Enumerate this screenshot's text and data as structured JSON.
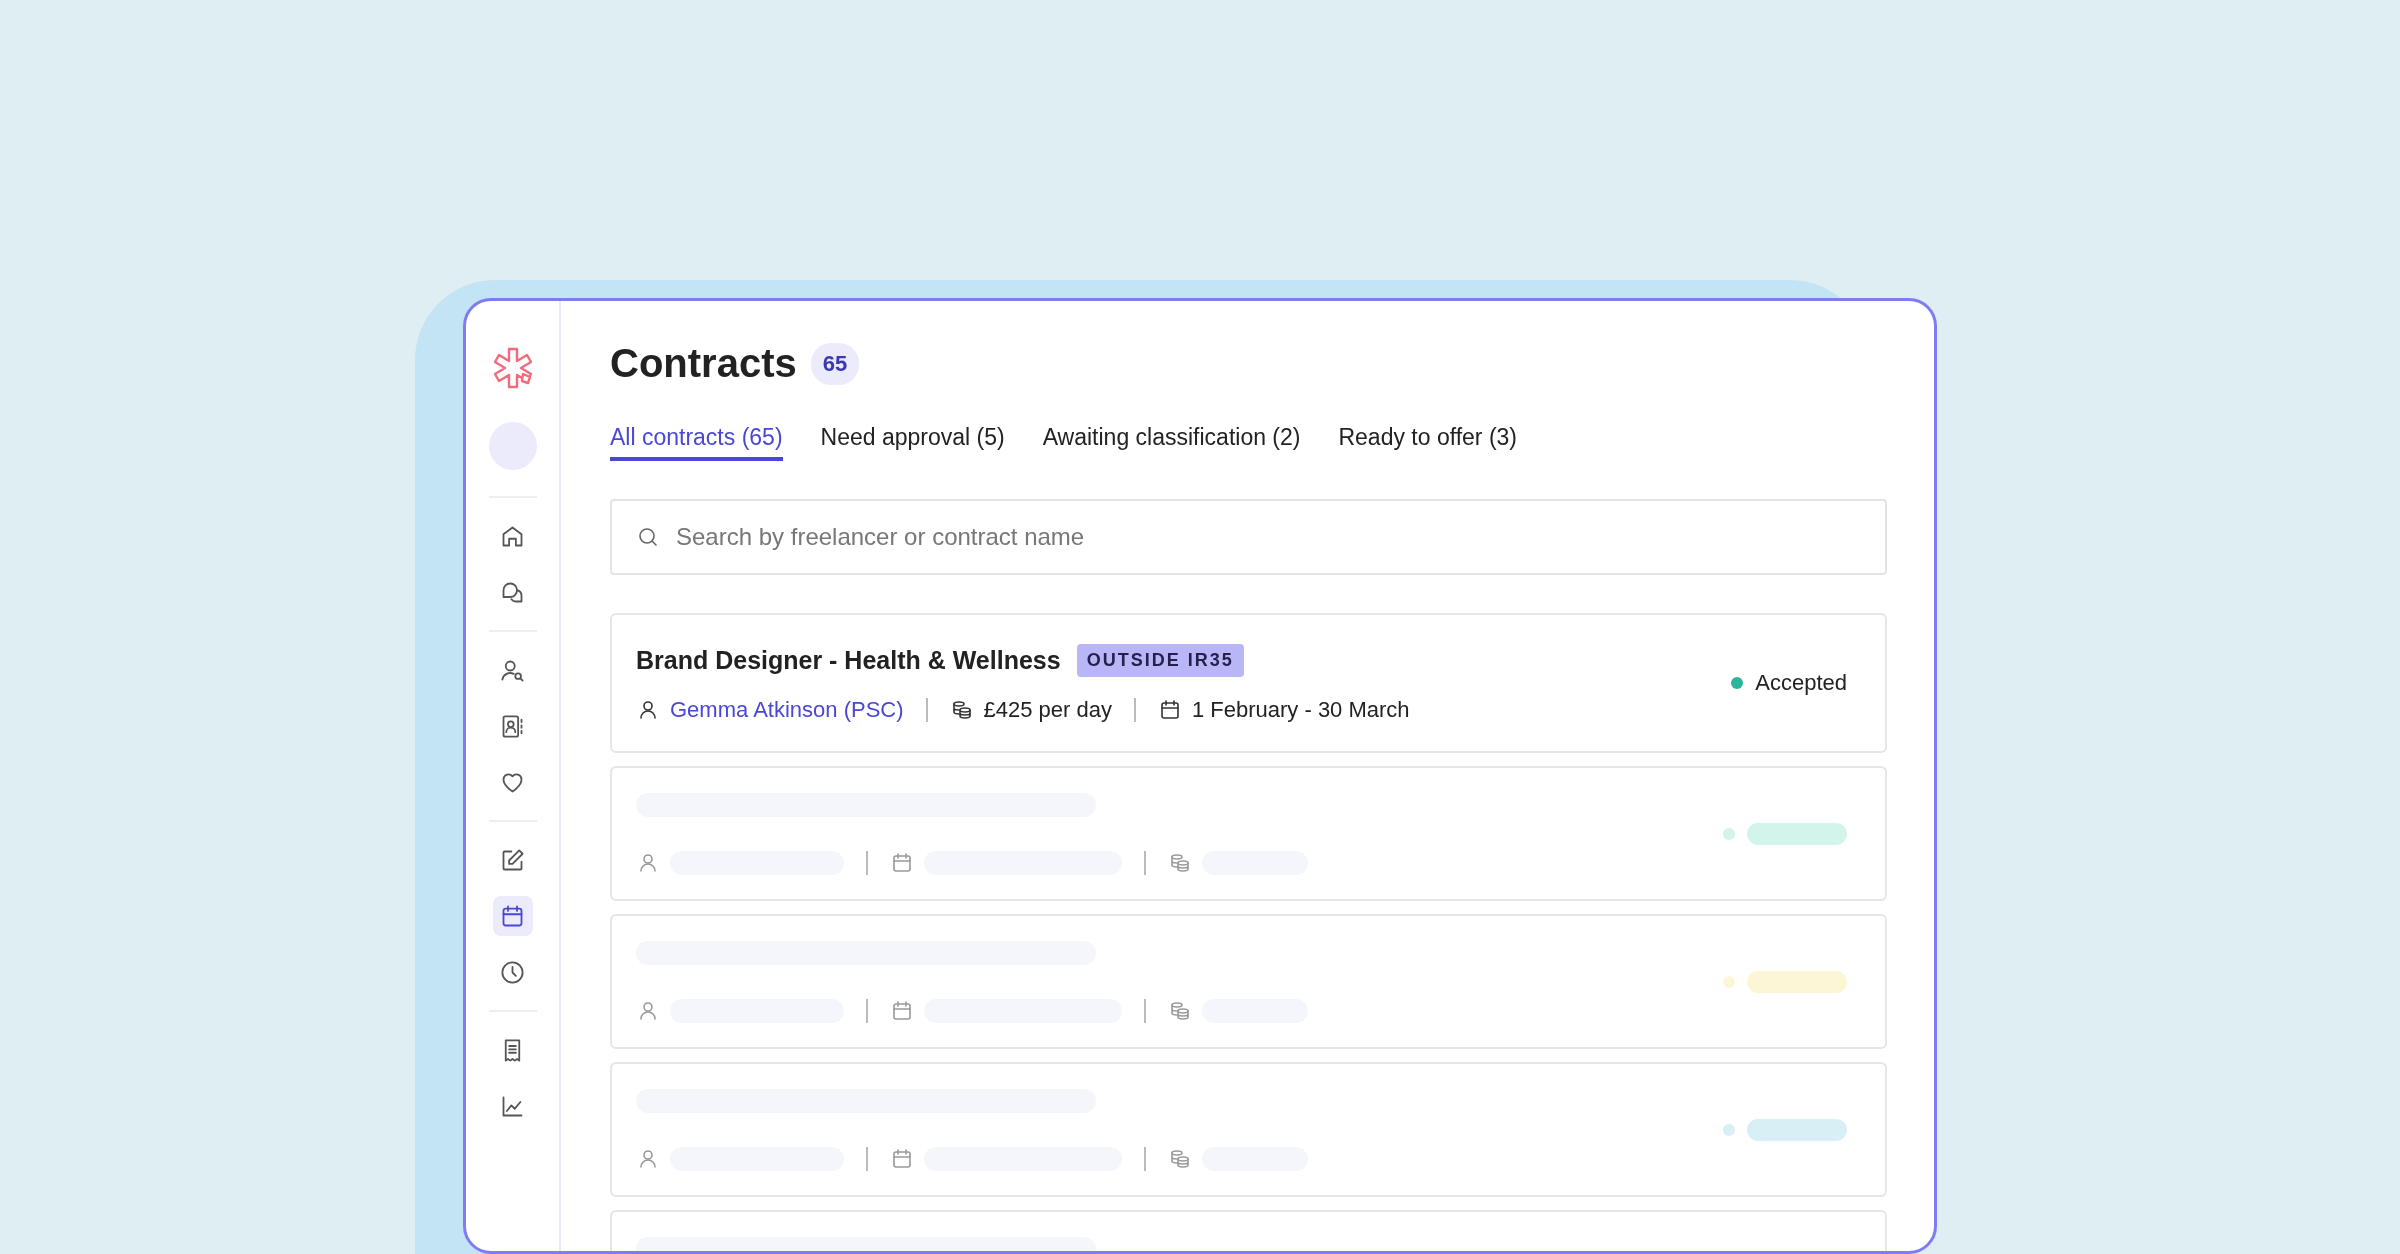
{
  "sidebar": {
    "groups": [
      {
        "items": [
          {
            "selected": false
          },
          {
            "selected": false
          }
        ]
      },
      {
        "items": [
          {
            "selected": false
          },
          {
            "selected": false
          },
          {
            "selected": false
          }
        ]
      },
      {
        "items": [
          {
            "selected": false
          },
          {
            "selected": true
          },
          {
            "selected": false
          }
        ]
      },
      {
        "items": [
          {
            "selected": false
          },
          {
            "selected": false
          }
        ]
      }
    ]
  },
  "header": {
    "title": "Contracts",
    "count": "65"
  },
  "tabs": [
    {
      "label": "All contracts (65)",
      "selected": true
    },
    {
      "label": "Need approval (5)",
      "selected": false
    },
    {
      "label": "Awaiting classification (2)",
      "selected": false
    },
    {
      "label": "Ready to offer (3)",
      "selected": false
    }
  ],
  "search": {
    "placeholder": "Search by freelancer or contract name"
  },
  "contract": {
    "title": "Brand Designer - Health & Wellness",
    "badge": "OUTSIDE IR35",
    "freelancer": "Gemma Atkinson (PSC)",
    "rate": "£425 per day",
    "dates": "1 February - 30 March",
    "status": "Accepted",
    "color": "#2bb59a"
  },
  "loading_rows": [
    {
      "color": "#d2f4ea"
    },
    {
      "color": "#fdf6d6"
    },
    {
      "color": "#d8eff5"
    }
  ]
}
